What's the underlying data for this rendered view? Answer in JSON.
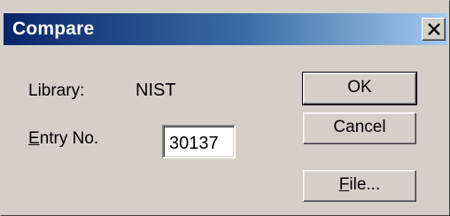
{
  "window": {
    "title": "Compare"
  },
  "form": {
    "library_label": "Library:",
    "library_value": "NIST",
    "entry_label": "Entry No.",
    "entry_value": "30137"
  },
  "buttons": {
    "ok_label": "OK",
    "cancel_label": "Cancel",
    "file_label": "File..."
  },
  "icons": {
    "close": "close-icon"
  },
  "colors": {
    "titlebar_start": "#0a246a",
    "titlebar_end": "#a6caf0",
    "dialog_face": "#d4d0c8"
  }
}
